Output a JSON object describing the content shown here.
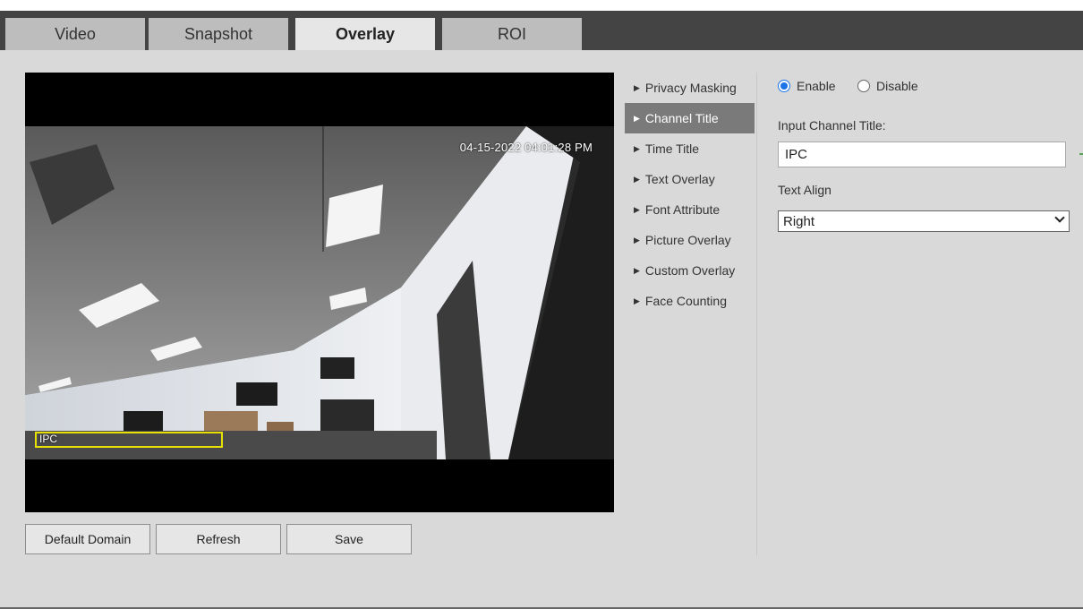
{
  "tabs": [
    {
      "label": "Video",
      "active": false
    },
    {
      "label": "Snapshot",
      "active": false
    },
    {
      "label": "Overlay",
      "active": true
    },
    {
      "label": "ROI",
      "active": false
    }
  ],
  "preview": {
    "timestamp": "04-15-2022 04:01:28 PM",
    "channel_label": "IPC"
  },
  "buttons": {
    "default_domain": "Default Domain",
    "refresh": "Refresh",
    "save": "Save"
  },
  "menu": [
    {
      "label": "Privacy Masking",
      "active": false
    },
    {
      "label": "Channel Title",
      "active": true
    },
    {
      "label": "Time Title",
      "active": false
    },
    {
      "label": "Text Overlay",
      "active": false
    },
    {
      "label": "Font Attribute",
      "active": false
    },
    {
      "label": "Picture Overlay",
      "active": false
    },
    {
      "label": "Custom Overlay",
      "active": false
    },
    {
      "label": "Face Counting",
      "active": false
    }
  ],
  "settings": {
    "enable_label": "Enable",
    "disable_label": "Disable",
    "enabled": true,
    "title_label": "Input Channel Title:",
    "title_value": "IPC",
    "align_label": "Text Align",
    "align_value": "Right"
  },
  "colors": {
    "tabbar": "#444444",
    "active_menu": "#7a7a7a",
    "radio_accent": "#1a73e8",
    "channel_box": "#e8e000"
  }
}
